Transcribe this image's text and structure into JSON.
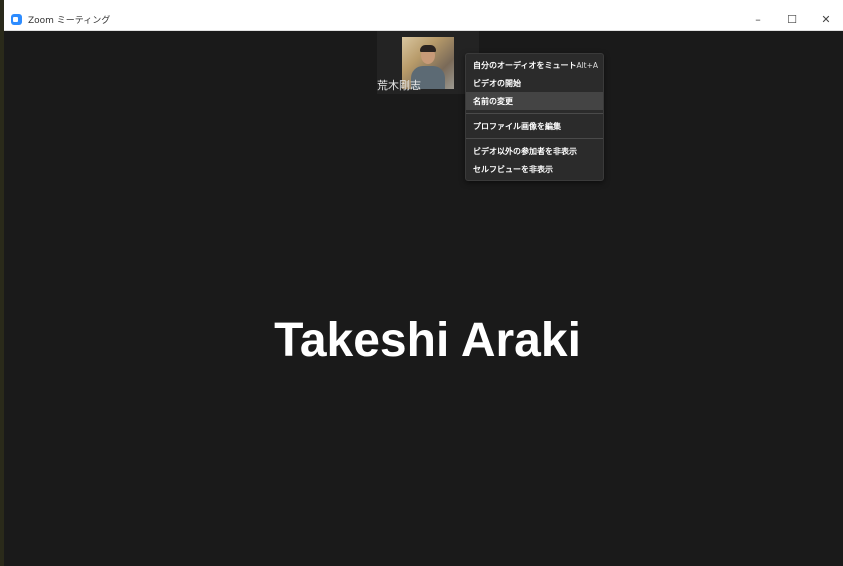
{
  "window": {
    "title": "Zoom ミーティング",
    "controls": {
      "minimize": "–",
      "maximize": "☐",
      "close": "✕"
    }
  },
  "thumbnail": {
    "name": "荒木剛志"
  },
  "main_display_name": "Takeshi Araki",
  "context_menu": {
    "items": [
      {
        "label": "自分のオーディオをミュート",
        "shortcut": "Alt+A"
      },
      {
        "label": "ビデオの開始"
      },
      {
        "label": "名前の変更",
        "highlighted": true
      },
      {
        "label": "プロファイル画像を編集"
      },
      {
        "label": "ビデオ以外の参加者を非表示"
      },
      {
        "label": "セルフビューを非表示"
      }
    ]
  },
  "colors": {
    "meeting_background": "#1a1a1a",
    "menu_background": "#2b2b2b",
    "menu_highlight": "#444444",
    "app_icon": "#2d8cff"
  },
  "icons": {
    "app": "zoom-app-icon"
  }
}
